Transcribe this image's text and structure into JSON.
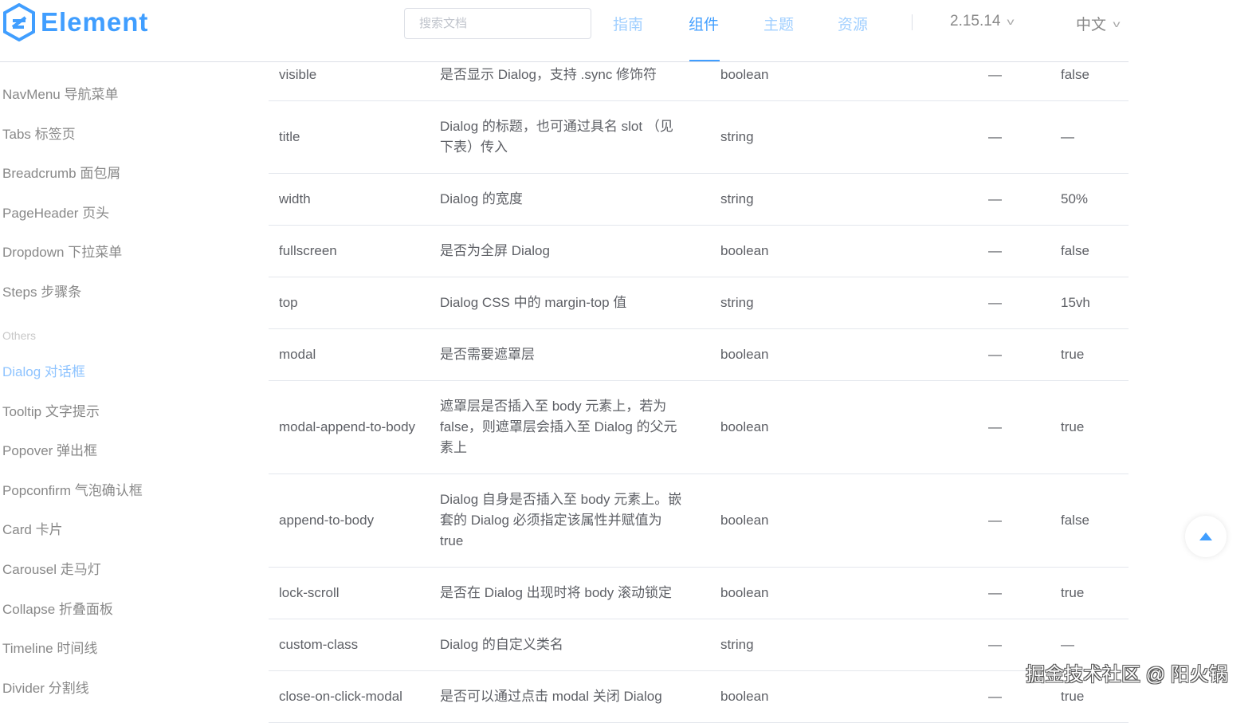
{
  "header": {
    "logo_text": "Element",
    "search_placeholder": "搜索文档",
    "nav": [
      "指南",
      "组件",
      "主题",
      "资源"
    ],
    "active_nav": 1,
    "version": "2.15.14",
    "language": "中文"
  },
  "sidebar": {
    "items_top": [
      "NavMenu 导航菜单",
      "Tabs 标签页",
      "Breadcrumb 面包屑",
      "PageHeader 页头",
      "Dropdown 下拉菜单",
      "Steps 步骤条"
    ],
    "group": "Others",
    "items_others": [
      "Dialog 对话框",
      "Tooltip 文字提示",
      "Popover 弹出框",
      "Popconfirm 气泡确认框",
      "Card 卡片",
      "Carousel 走马灯",
      "Collapse 折叠面板",
      "Timeline 时间线",
      "Divider 分割线"
    ],
    "active": "Dialog 对话框"
  },
  "table": {
    "rows": [
      [
        "visible",
        "是否显示 Dialog，支持 .sync 修饰符",
        "boolean",
        "—",
        "false"
      ],
      [
        "title",
        "Dialog 的标题，也可通过具名 slot （见\n下表）传入",
        "string",
        "—",
        "—"
      ],
      [
        "width",
        "Dialog 的宽度",
        "string",
        "—",
        "50%"
      ],
      [
        "fullscreen",
        "是否为全屏 Dialog",
        "boolean",
        "—",
        "false"
      ],
      [
        "top",
        "Dialog CSS 中的 margin-top 值",
        "string",
        "—",
        "15vh"
      ],
      [
        "modal",
        "是否需要遮罩层",
        "boolean",
        "—",
        "true"
      ],
      [
        "modal-append-to-body",
        "遮罩层是否插入至 body 元素上，若为\nfalse，则遮罩层会插入至 Dialog 的父元\n素上",
        "boolean",
        "—",
        "true"
      ],
      [
        "append-to-body",
        "Dialog 自身是否插入至 body 元素上。嵌\n套的 Dialog 必须指定该属性并赋值为\ntrue",
        "boolean",
        "—",
        "false"
      ],
      [
        "lock-scroll",
        "是否在 Dialog 出现时将 body 滚动锁定",
        "boolean",
        "—",
        "true"
      ],
      [
        "custom-class",
        "Dialog 的自定义类名",
        "string",
        "—",
        "—"
      ],
      [
        "close-on-click-modal",
        "是否可以通过点击 modal 关闭 Dialog",
        "boolean",
        "—",
        "true"
      ]
    ]
  },
  "watermark": "掘金技术社区 @ 阳火锅",
  "colors": {
    "accent": "#409eff"
  }
}
